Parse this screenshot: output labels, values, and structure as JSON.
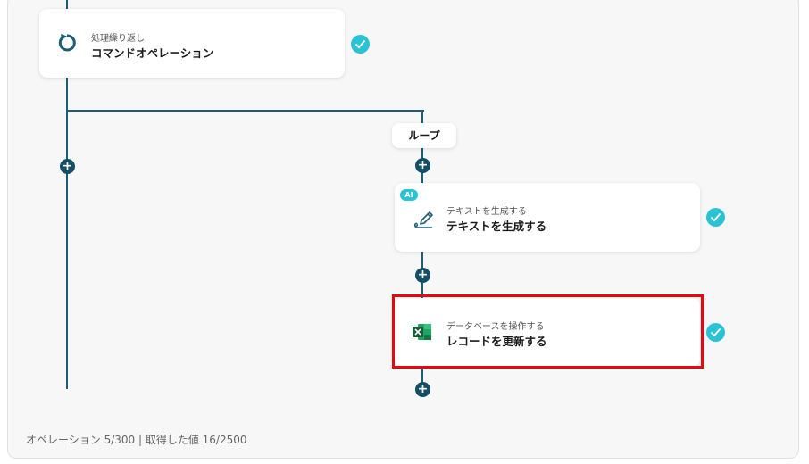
{
  "flow": {
    "repeat_card": {
      "subtitle": "処理繰り返し",
      "title": "コマンドオペレーション",
      "icon": "refresh-icon"
    },
    "loop_label": "ループ",
    "ai_badge": "AI",
    "text_gen_card": {
      "subtitle": "テキストを生成する",
      "title": "テキストを生成する",
      "icon": "pen-icon"
    },
    "db_card": {
      "subtitle": "データベースを操作する",
      "title": "レコードを更新する",
      "icon": "excel-icon"
    }
  },
  "footer": {
    "text": "オペレーション 5/300 | 取得した値 16/2500"
  },
  "colors": {
    "line": "#1c5d78",
    "check": "#2bc3d4",
    "highlight": "#e5090f",
    "excel": "#1d6f42"
  }
}
